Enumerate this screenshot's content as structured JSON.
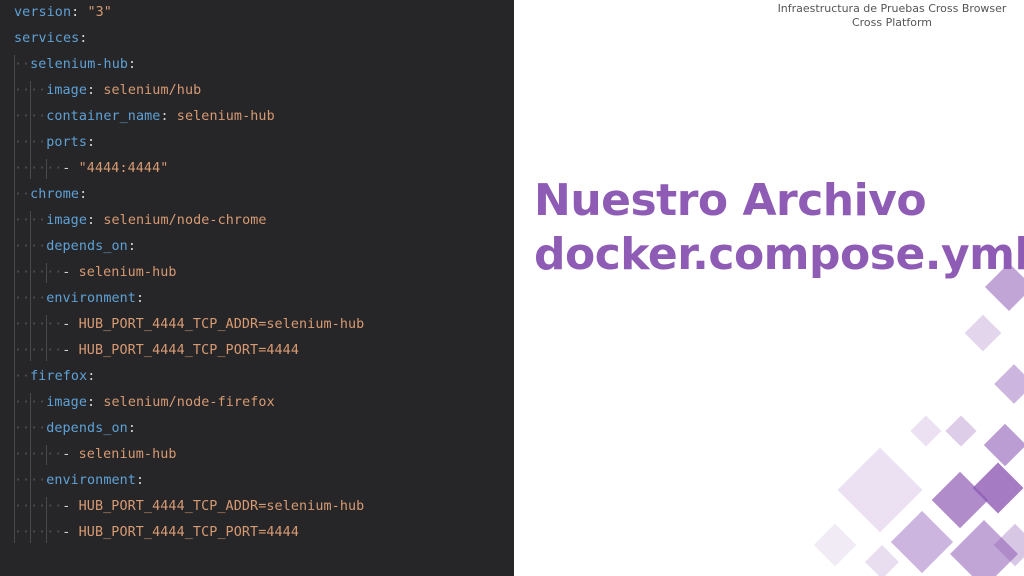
{
  "header": {
    "line1": "Infraestructura de Pruebas Cross Browser",
    "line2": "Cross Platform"
  },
  "title": {
    "line1": "Nuestro Archivo",
    "line2": "docker.compose.yml"
  },
  "code": {
    "lines": [
      {
        "indent": 0,
        "key": "version",
        "sep": ": ",
        "value": "\"3\""
      },
      {
        "indent": 0,
        "key": "services",
        "sep": ":",
        "value": ""
      },
      {
        "indent": 1,
        "key": "selenium-hub",
        "sep": ":",
        "value": ""
      },
      {
        "indent": 2,
        "key": "image",
        "sep": ": ",
        "value": "selenium/hub"
      },
      {
        "indent": 2,
        "key": "container_name",
        "sep": ": ",
        "value": "selenium-hub"
      },
      {
        "indent": 2,
        "key": "ports",
        "sep": ":",
        "value": ""
      },
      {
        "indent": 3,
        "key": "",
        "sep": "",
        "value": "\"4444:4444\"",
        "dash": "-"
      },
      {
        "indent": 1,
        "key": "chrome",
        "sep": ":",
        "value": ""
      },
      {
        "indent": 2,
        "key": "image",
        "sep": ": ",
        "value": "selenium/node-chrome"
      },
      {
        "indent": 2,
        "key": "depends_on",
        "sep": ":",
        "value": ""
      },
      {
        "indent": 3,
        "key": "",
        "sep": "",
        "value": "selenium-hub",
        "dash": "-"
      },
      {
        "indent": 2,
        "key": "environment",
        "sep": ":",
        "value": ""
      },
      {
        "indent": 3,
        "key": "",
        "sep": "",
        "value": "HUB_PORT_4444_TCP_ADDR=selenium-hub",
        "dash": "-"
      },
      {
        "indent": 3,
        "key": "",
        "sep": "",
        "value": "HUB_PORT_4444_TCP_PORT=4444",
        "dash": "-"
      },
      {
        "indent": 1,
        "key": "firefox",
        "sep": ":",
        "value": ""
      },
      {
        "indent": 2,
        "key": "image",
        "sep": ": ",
        "value": "selenium/node-firefox"
      },
      {
        "indent": 2,
        "key": "depends_on",
        "sep": ":",
        "value": ""
      },
      {
        "indent": 3,
        "key": "",
        "sep": "",
        "value": "selenium-hub",
        "dash": "-"
      },
      {
        "indent": 2,
        "key": "environment",
        "sep": ":",
        "value": ""
      },
      {
        "indent": 3,
        "key": "",
        "sep": "",
        "value": "HUB_PORT_4444_TCP_ADDR=selenium-hub",
        "dash": "-"
      },
      {
        "indent": 3,
        "key": "",
        "sep": "",
        "value": "HUB_PORT_4444_TCP_PORT=4444",
        "dash": "-"
      }
    ]
  },
  "colors": {
    "code_bg": "#262628",
    "yaml_key": "#5ea1d6",
    "yaml_value": "#d89a72",
    "title": "#8e5bb5"
  }
}
